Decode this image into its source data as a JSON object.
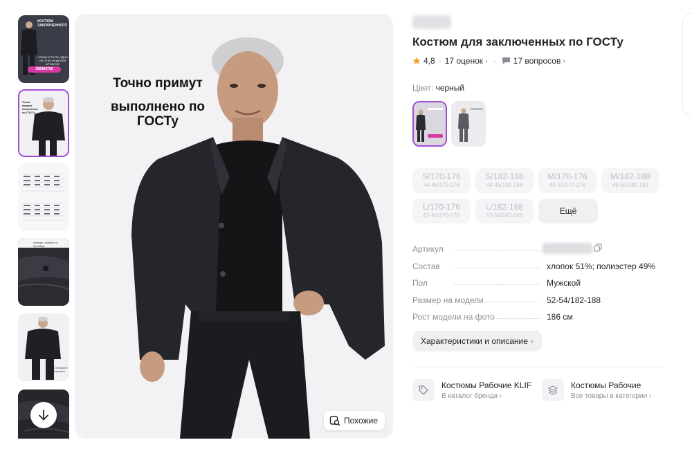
{
  "thumbnails": {
    "first_caption": "КОСТЮМ ЗАКЛЮЧЕННОГО",
    "first_promo": "ЧТОБЫ КУПИТЬ ОДИН ИЗ ЭТИХ МОДЕЛЕЙ АРТИКУЛУ",
    "first_article": "256860756",
    "second_caption": "Точно примут выполнено по ГОСТу",
    "fourth_caption": "нагрудн. карман на пуговице",
    "fifth_caption": "2 внешних кармана"
  },
  "main_photo": {
    "promo_line1": "Точно примут",
    "promo_line2": "выполнено по ГОСТу",
    "similar_label": "Похожие"
  },
  "product": {
    "title": "Костюм для заключенных по ГОСТу",
    "rating": "4,8",
    "reviews": "17 оценок",
    "questions": "17 вопросов",
    "color_label": "Цвет:",
    "color_value": "черный",
    "more_sizes_label": "Ещё",
    "sizes": [
      {
        "main": "S/170-176",
        "sub": "44-46/170-176"
      },
      {
        "main": "S/182-188",
        "sub": "44-46/182-188"
      },
      {
        "main": "M/170-176",
        "sub": "48-50/170-176"
      },
      {
        "main": "M/182-188",
        "sub": "48-50/182-188"
      },
      {
        "main": "L/170-176",
        "sub": "52-54/170-176"
      },
      {
        "main": "L/182-188",
        "sub": "52-54/182-188"
      }
    ],
    "specs": [
      {
        "key": "Артикул",
        "value": ""
      },
      {
        "key": "Состав",
        "value": "хлопок 51%; полиэстер 49%"
      },
      {
        "key": "Пол",
        "value": "Мужской"
      },
      {
        "key": "Размер на модели",
        "value": "52-54/182-188"
      },
      {
        "key": "Рост модели на фото",
        "value": "186 см"
      }
    ],
    "characteristics_label": "Характеристики и описание"
  },
  "links": [
    {
      "title": "Костюмы Рабочие KLIF",
      "subtitle": "В каталог бренда",
      "icon": "tag-icon"
    },
    {
      "title": "Костюмы Рабочие",
      "subtitle": "Все товары в категории",
      "icon": "layers-icon"
    }
  ],
  "colors": {
    "accent": "#a44bd6",
    "star": "#f6a123",
    "promo_pink": "#d83aa4"
  }
}
